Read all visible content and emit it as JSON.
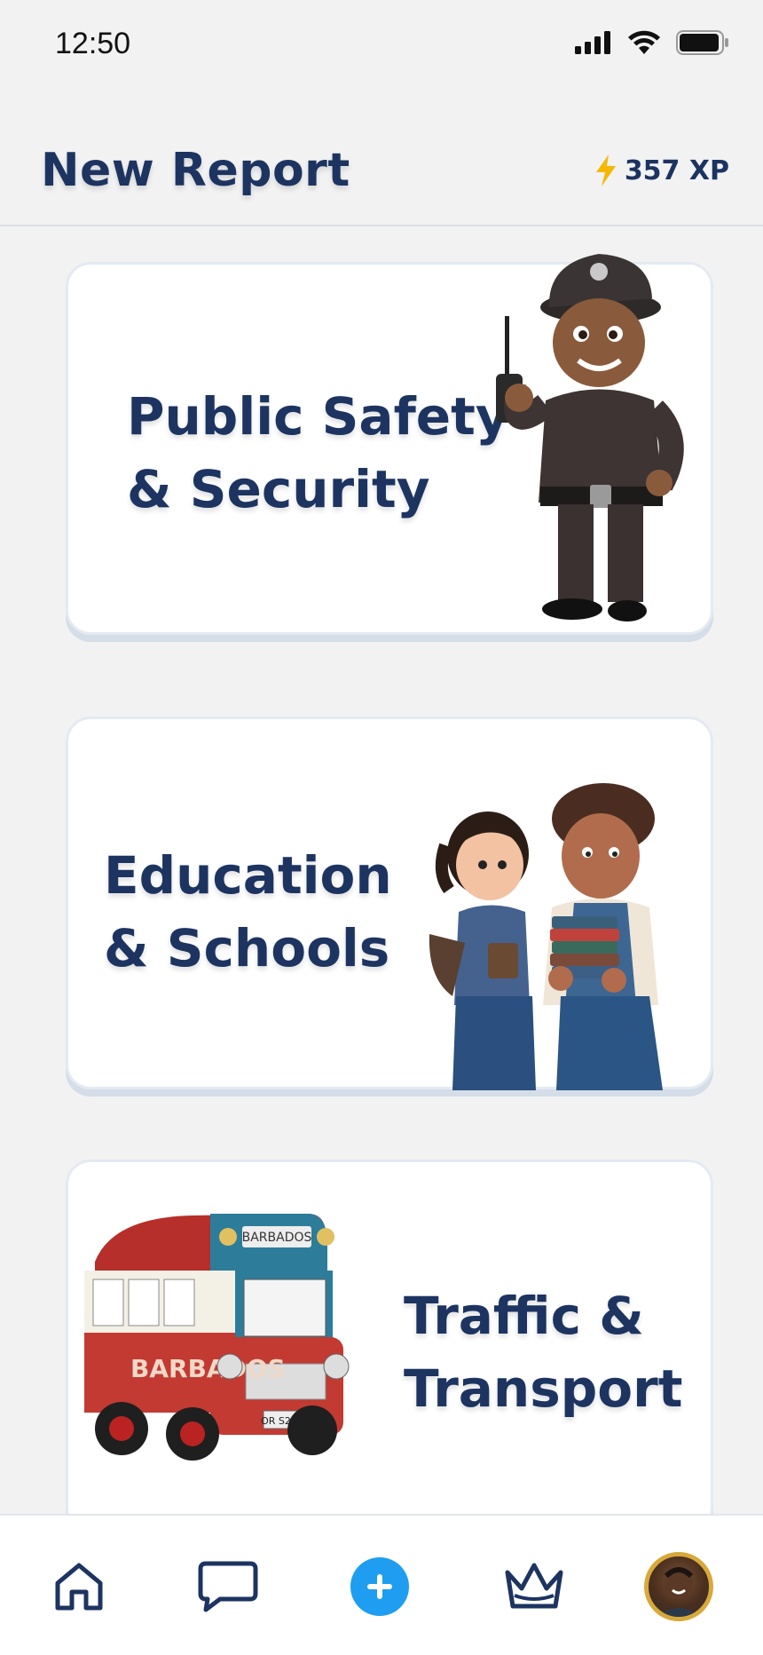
{
  "status_bar": {
    "time": "12:50"
  },
  "header": {
    "title": "New Report",
    "xp": "357 XP"
  },
  "categories": [
    {
      "line1": "Public Safety",
      "line2": "& Security"
    },
    {
      "line1": "Education",
      "line2": "& Schools"
    },
    {
      "line1": "Traffic &",
      "line2": "Transport"
    }
  ],
  "bus_sign": "BARBADOS",
  "bus_side": "BARBADOS",
  "bus_plate": "OR S219",
  "bottom_nav": [
    "home-icon",
    "chat-icon",
    "add-icon",
    "crown-icon",
    "profile-avatar"
  ],
  "colors": {
    "title": "#1d3461",
    "accent": "#1e9df1",
    "xp_bolt": "#f5b800",
    "avatar_ring": "#d8a93a"
  }
}
